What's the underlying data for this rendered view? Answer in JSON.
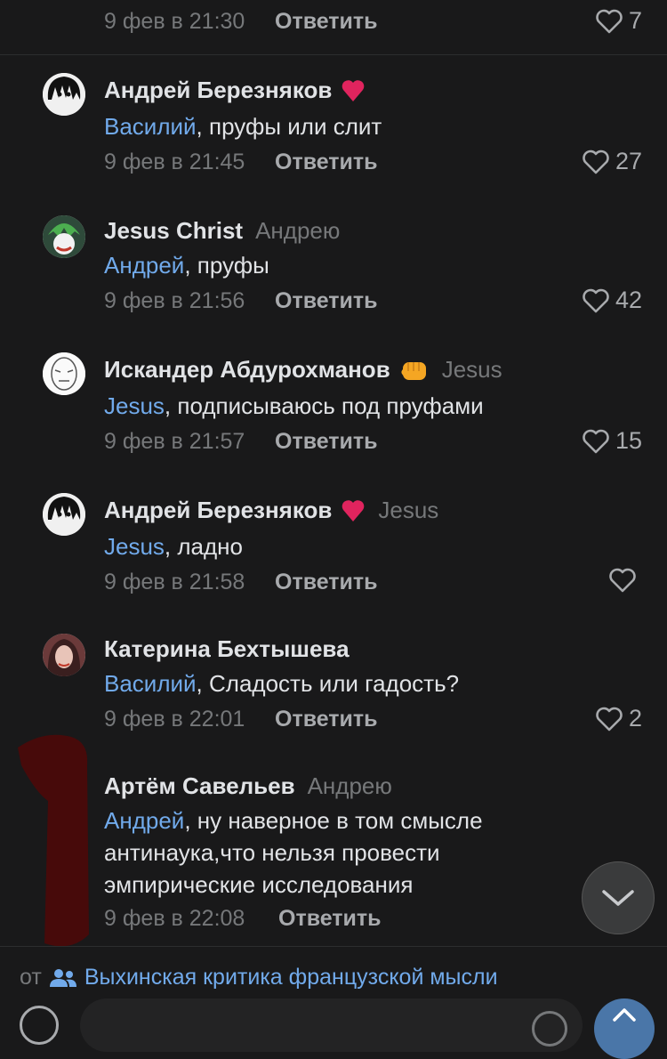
{
  "top_meta": {
    "date": "9 фев в 21:30",
    "reply": "Ответить",
    "likes": "7"
  },
  "comments": [
    {
      "author": "Андрей Березняков",
      "badge": "heart",
      "reply_to": "",
      "mention": "Василий",
      "text": ", пруфы или слит",
      "date": "9 фев в 21:45",
      "reply": "Ответить",
      "likes": "27"
    },
    {
      "author": "Jesus Christ",
      "badge": "",
      "reply_to": "Андрею",
      "mention": "Андрей",
      "text": ", пруфы",
      "date": "9 фев в 21:56",
      "reply": "Ответить",
      "likes": "42"
    },
    {
      "author": "Искандер Абдурохманов",
      "badge": "fist",
      "reply_to": "Jesus",
      "mention": "Jesus",
      "text": ", подписываюсь под пруфами",
      "date": "9 фев в 21:57",
      "reply": "Ответить",
      "likes": "15"
    },
    {
      "author": "Андрей Березняков",
      "badge": "heart",
      "reply_to": "Jesus",
      "mention": "Jesus",
      "text": ", ладно",
      "date": "9 фев в 21:58",
      "reply": "Ответить",
      "likes": ""
    },
    {
      "author": "Катерина Бехтышева",
      "badge": "",
      "reply_to": "",
      "mention": "Василий",
      "text": ", Сладость или гадость?",
      "date": "9 фев в 22:01",
      "reply": "Ответить",
      "likes": "2"
    },
    {
      "author": "Артём Савельев",
      "badge": "",
      "reply_to": "Андрею",
      "mention": "Андрей",
      "text": ", ну наверное в том смысле антинаука,что нельзя провести эмпирические исследования",
      "date": "9 фев в 22:08",
      "reply": "Ответить",
      "likes": ""
    }
  ],
  "source": {
    "prefix": "от",
    "group": "Выхинская критика французской мысли"
  },
  "colors": {
    "background": "#19191a",
    "link": "#71aaeb",
    "badge_heart": "#e0245e",
    "fist": "#f5a623"
  }
}
